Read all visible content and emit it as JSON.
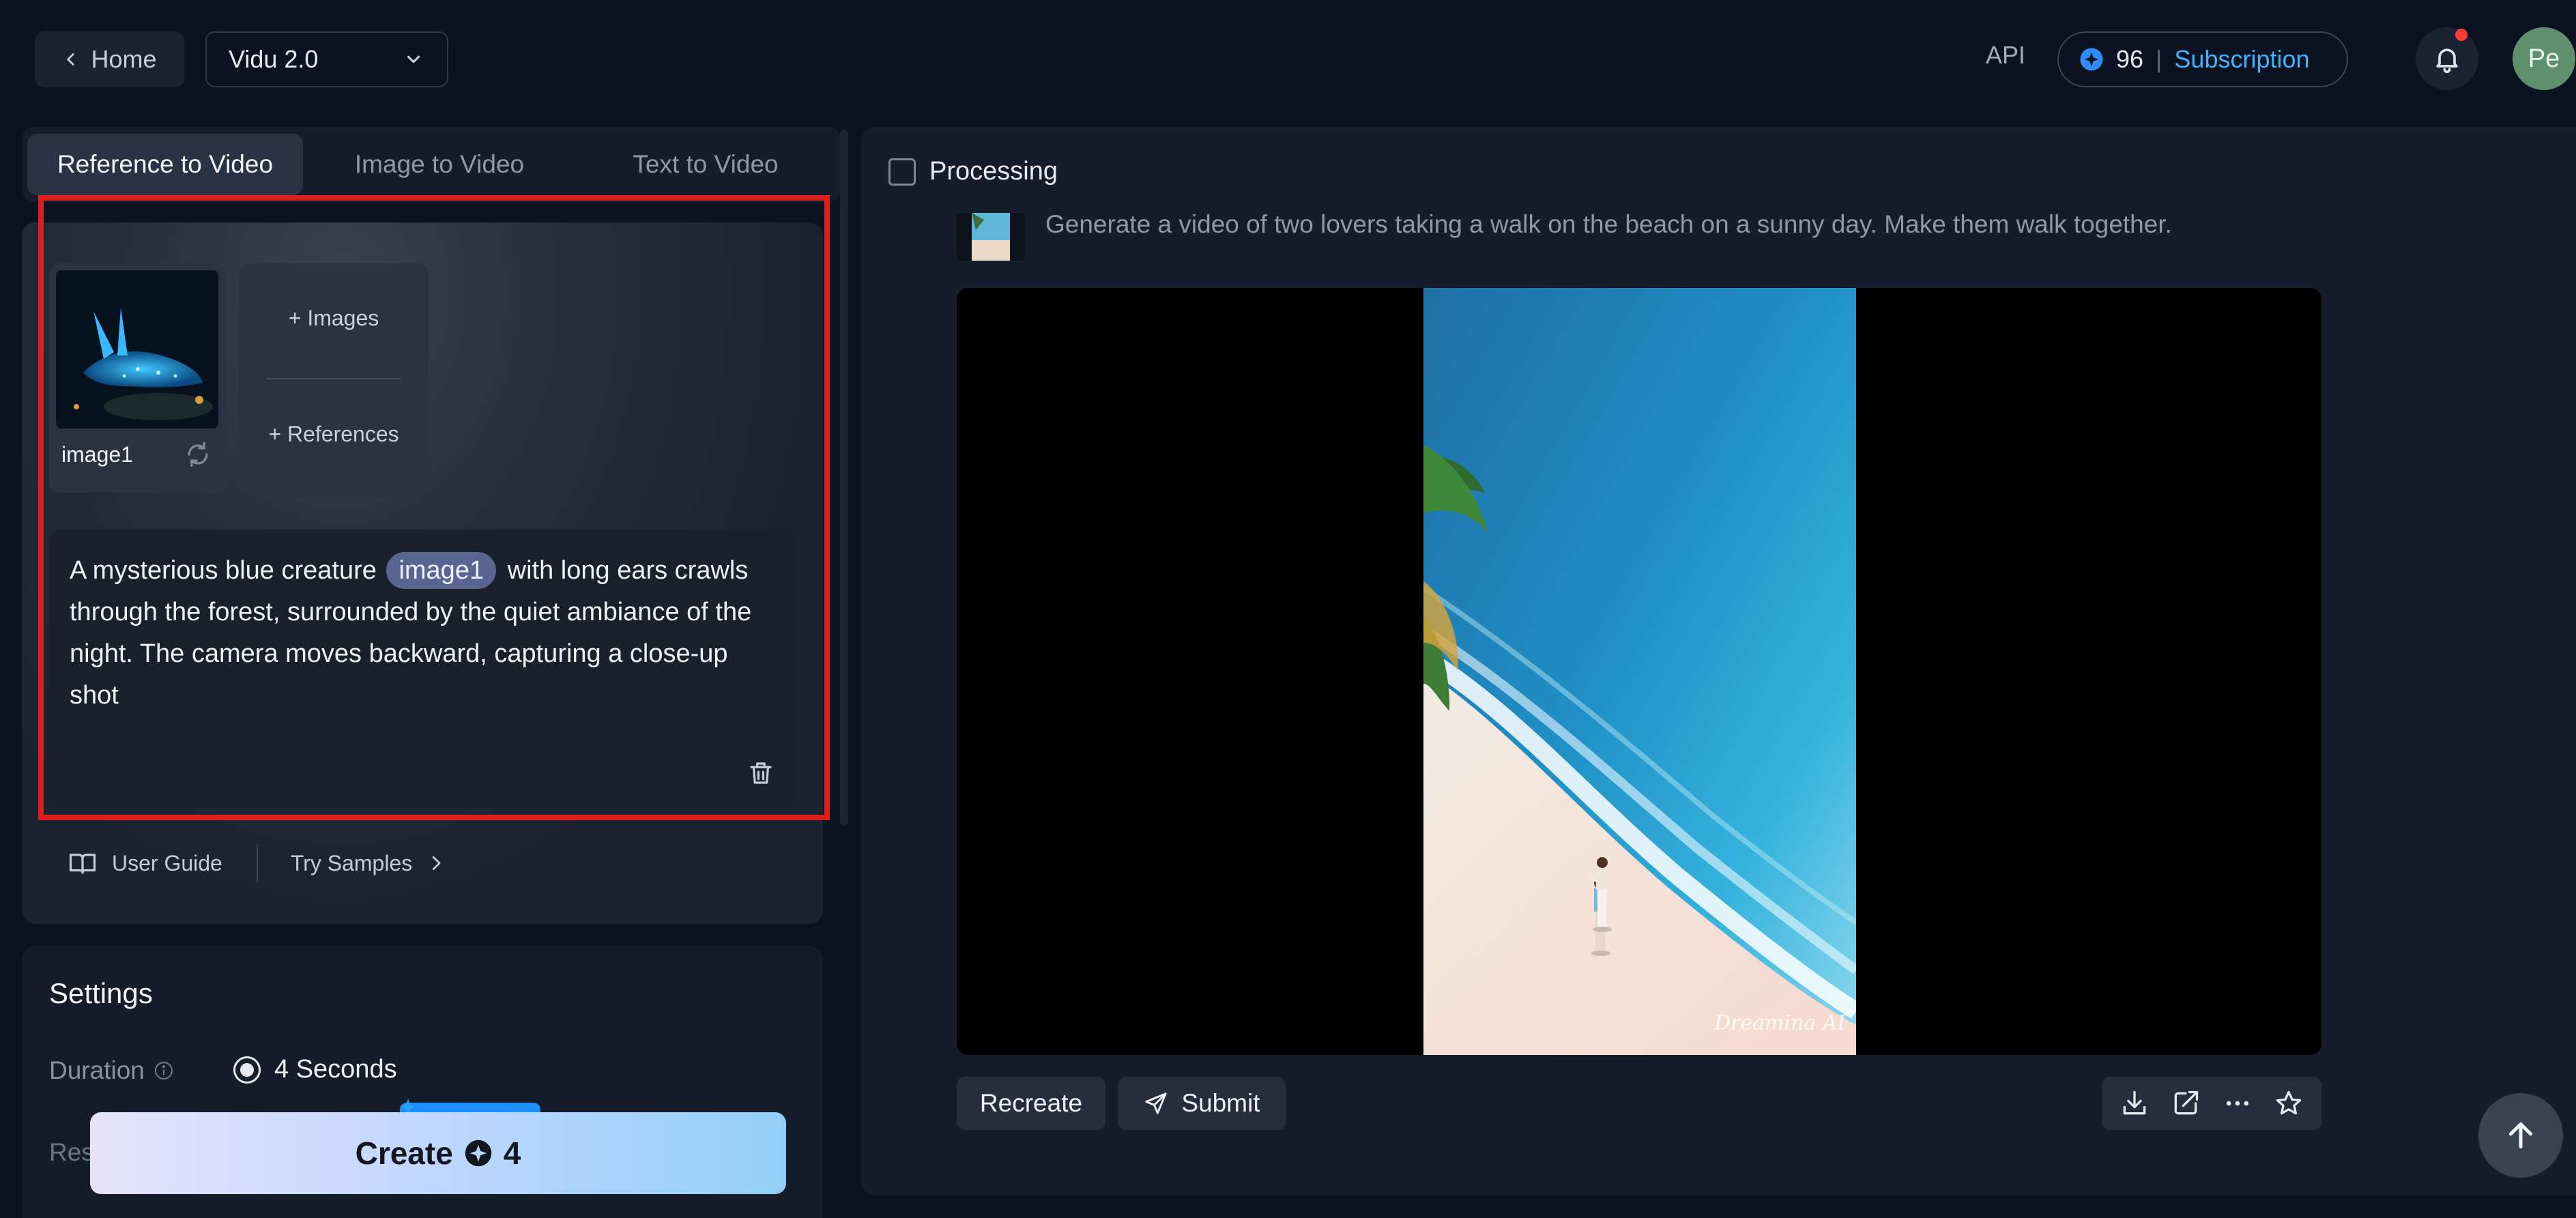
{
  "header": {
    "home_label": "Home",
    "model_value": "Vidu 2.0",
    "api_label": "API",
    "credits": "96",
    "separator": "|",
    "subscription_label": "Subscription",
    "avatar_initials": "Pe"
  },
  "modes": {
    "tabs": [
      {
        "label": "Reference to Video",
        "active": true
      },
      {
        "label": "Image to Video",
        "active": false
      },
      {
        "label": "Text to Video",
        "active": false
      }
    ]
  },
  "reference": {
    "image_label": "image1",
    "add_images_label": "+ Images",
    "add_references_label": "+ References"
  },
  "prompt": {
    "before_tag": "A mysterious blue creature",
    "tag": "image1",
    "after_tag": "with long ears crawls through the forest, surrounded by the quiet ambiance of the night. The camera moves backward, capturing a close-up shot"
  },
  "links": {
    "user_guide": "User Guide",
    "try_samples": "Try Samples"
  },
  "settings": {
    "title": "Settings",
    "duration_label": "Duration",
    "duration_value": "4 Seconds",
    "resolution_label": "Res"
  },
  "create": {
    "label": "Create",
    "cost": "4"
  },
  "result": {
    "status_label": "Processing",
    "prompt_text": "Generate a video of two lovers taking a walk on the beach on a sunny day. Make them walk together.",
    "watermark": "Dreamina AI",
    "recreate_label": "Recreate",
    "submit_label": "Submit"
  },
  "colors": {
    "background": "#0b1220",
    "panel": "#161d2a",
    "accent_blue": "#3fb3ff",
    "highlight_red": "#e01e1e",
    "notification_dot": "#ff3b3b"
  },
  "icons": [
    "chevron-left-icon",
    "chevron-down-icon",
    "credit-coin-icon",
    "bell-icon",
    "swap-icon",
    "plus-icon",
    "trash-icon",
    "book-icon",
    "chevron-right-icon",
    "info-icon",
    "send-icon",
    "download-icon",
    "share-icon",
    "more-icon",
    "star-icon",
    "arrow-up-icon"
  ]
}
